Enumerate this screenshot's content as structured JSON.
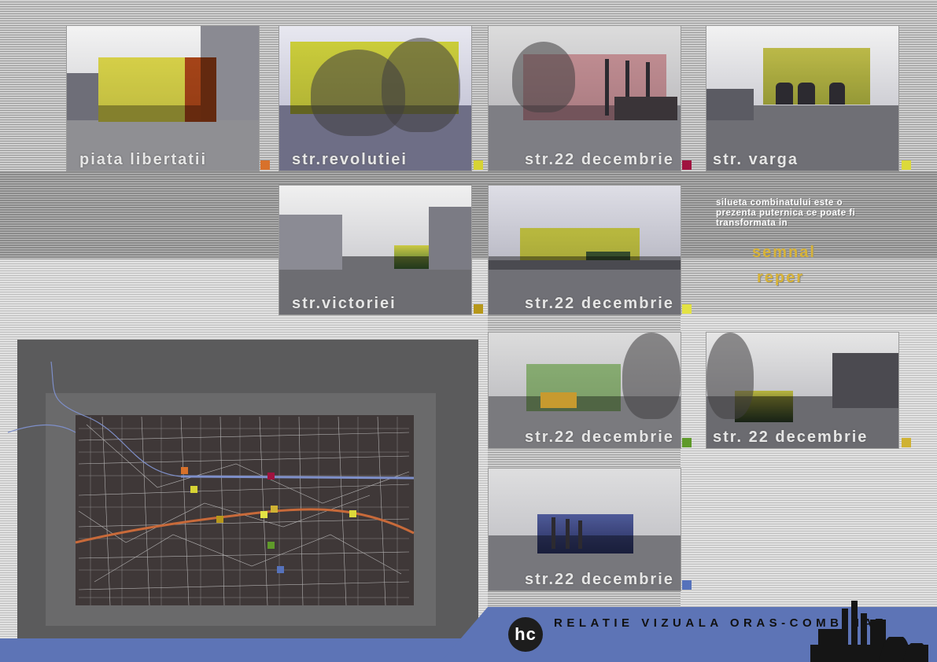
{
  "photos": [
    {
      "caption": "piata libertatii",
      "swatch": "#d8712b"
    },
    {
      "caption": "str.revolutiei",
      "swatch": "#d7d334"
    },
    {
      "caption": "str.22 decembrie",
      "swatch": "#a0133f"
    },
    {
      "caption": "str. varga",
      "swatch": "#dcd93a"
    },
    {
      "caption": "str.victoriei",
      "swatch": "#b7981a"
    },
    {
      "caption": "str.22 decembrie",
      "swatch": "#e3e244"
    },
    {
      "caption": "str.22 decembrie",
      "swatch": "#5f9a2a"
    },
    {
      "caption": "str. 22 decembrie",
      "swatch": "#cfb233"
    },
    {
      "caption": "str.22 decembrie",
      "swatch": "#5672bb"
    }
  ],
  "side_text": {
    "line1": "silueta combinatului este o",
    "line2": "prezenta puternica ce poate fi",
    "line3": "transformata in",
    "highlight1": "semnal",
    "highlight2": "reper"
  },
  "footer": {
    "logo": "hc",
    "title": "RELATIE VIZUALA ORAS-COMBINAT"
  },
  "colors": {
    "accent_blue": "#5d74b6",
    "route_orange": "#c86a3a",
    "route_blue": "#7e8fc9"
  }
}
